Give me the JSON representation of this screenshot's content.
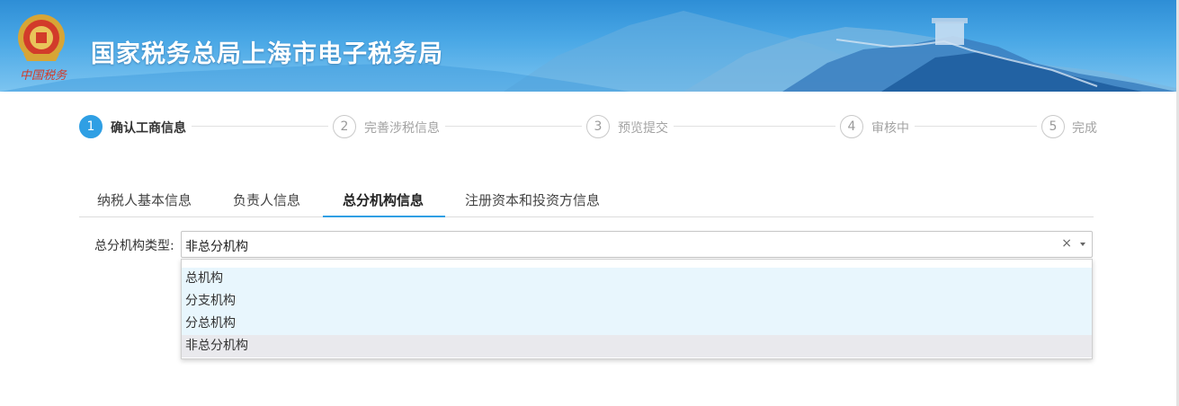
{
  "header": {
    "title": "国家税务总局上海市电子税务局",
    "emblem_caption": "中国税务"
  },
  "steps": [
    {
      "num": "1",
      "label": "确认工商信息",
      "active": true
    },
    {
      "num": "2",
      "label": "完善涉税信息",
      "active": false
    },
    {
      "num": "3",
      "label": "预览提交",
      "active": false
    },
    {
      "num": "4",
      "label": "审核中",
      "active": false
    },
    {
      "num": "5",
      "label": "完成",
      "active": false
    }
  ],
  "tabs": [
    {
      "label": "纳税人基本信息"
    },
    {
      "label": "负责人信息"
    },
    {
      "label": "总分机构信息",
      "active": true
    },
    {
      "label": "注册资本和投资方信息"
    }
  ],
  "form": {
    "org_type_label": "总分机构类型:",
    "org_type_value": "非总分机构",
    "clear_glyph": "×"
  },
  "dropdown": {
    "options": [
      "总机构",
      "分支机构",
      "分总机构",
      "非总分机构"
    ],
    "selected": "非总分机构"
  },
  "colors": {
    "accent": "#2f9fe4",
    "header_blue": "#2e8ed6",
    "option_highlight": "#e8f6fd",
    "option_selected": "#e9e9ed"
  }
}
